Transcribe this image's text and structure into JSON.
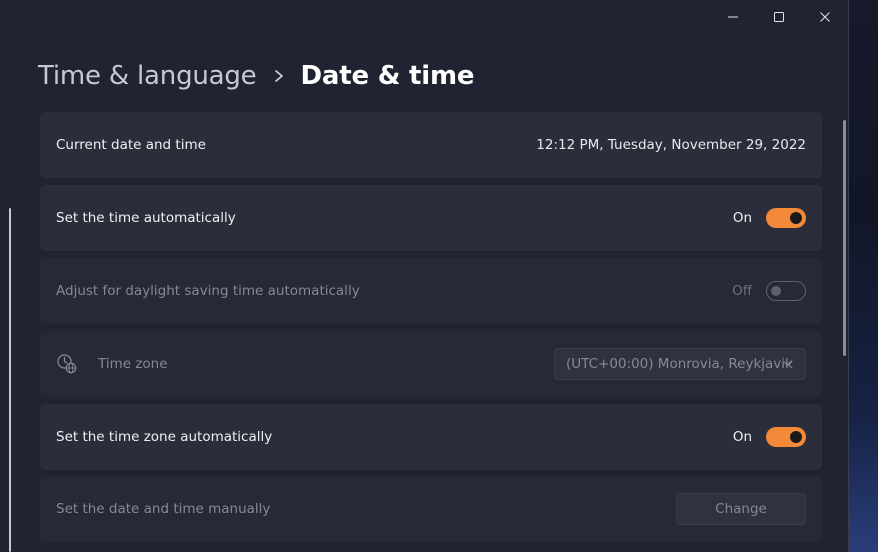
{
  "window": {
    "caption_buttons": [
      "minimize",
      "maximize",
      "close"
    ]
  },
  "breadcrumb": {
    "parent": "Time & language",
    "separator_icon": "chevron-right-icon",
    "current": "Date & time"
  },
  "settings": {
    "current_datetime": {
      "label": "Current date and time",
      "value": "12:12 PM, Tuesday, November 29, 2022"
    },
    "set_time_auto": {
      "label": "Set the time automatically",
      "state_label": "On",
      "on": true
    },
    "daylight_saving": {
      "label": "Adjust for daylight saving time automatically",
      "state_label": "Off",
      "on": false,
      "disabled": true
    },
    "time_zone": {
      "icon": "globe-clock-icon",
      "label": "Time zone",
      "selected": "(UTC+00:00) Monrovia, Reykjavik",
      "disabled": true
    },
    "set_tz_auto": {
      "label": "Set the time zone automatically",
      "state_label": "On",
      "on": true
    },
    "manual": {
      "label": "Set the date and time manually",
      "button_label": "Change",
      "disabled": true
    }
  },
  "colors": {
    "accent": "#f5893a",
    "window_bg": "#202331",
    "card_bg": "#2b2d3a"
  }
}
